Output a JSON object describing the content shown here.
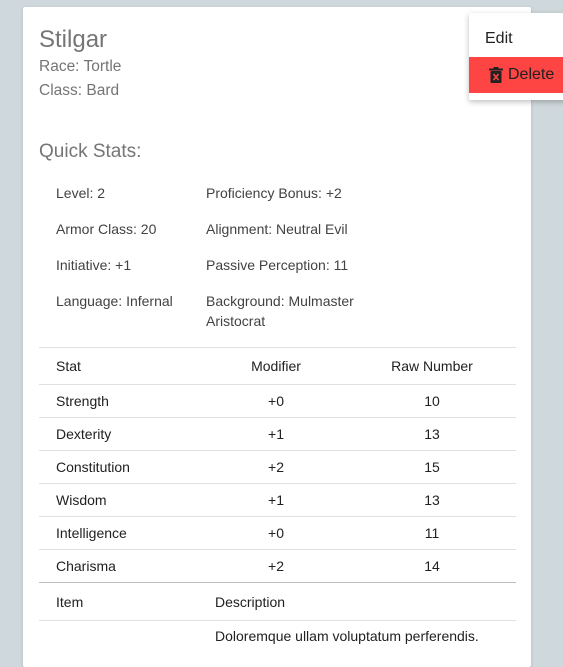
{
  "character": {
    "name": "Stilgar",
    "race": "Race: Tortle",
    "class": "Class: Bard"
  },
  "quick_stats": {
    "title": "Quick Stats:",
    "level": "Level: 2",
    "proficiency": "Proficiency Bonus: +2",
    "armor_class": "Armor Class: 20",
    "alignment": "Alignment: Neutral Evil",
    "initiative": "Initiative: +1",
    "passive_perception": "Passive Perception: 11",
    "language": "Language: Infernal",
    "background": "Background: Mulmaster Aristocrat"
  },
  "stats_table": {
    "headers": [
      "Stat",
      "Modifier",
      "Raw Number"
    ],
    "rows": [
      [
        "Strength",
        "+0",
        "10"
      ],
      [
        "Dexterity",
        "+1",
        "13"
      ],
      [
        "Constitution",
        "+2",
        "15"
      ],
      [
        "Wisdom",
        "+1",
        "13"
      ],
      [
        "Intelligence",
        "+0",
        "11"
      ],
      [
        "Charisma",
        "+2",
        "14"
      ]
    ]
  },
  "items_table": {
    "headers": [
      "Item",
      "Description"
    ],
    "rows": [
      [
        "",
        "Doloremque ullam voluptatum perferendis."
      ]
    ]
  },
  "menu": {
    "edit_label": "Edit",
    "delete_label": "Delete",
    "delete_color": "#ff4444"
  }
}
